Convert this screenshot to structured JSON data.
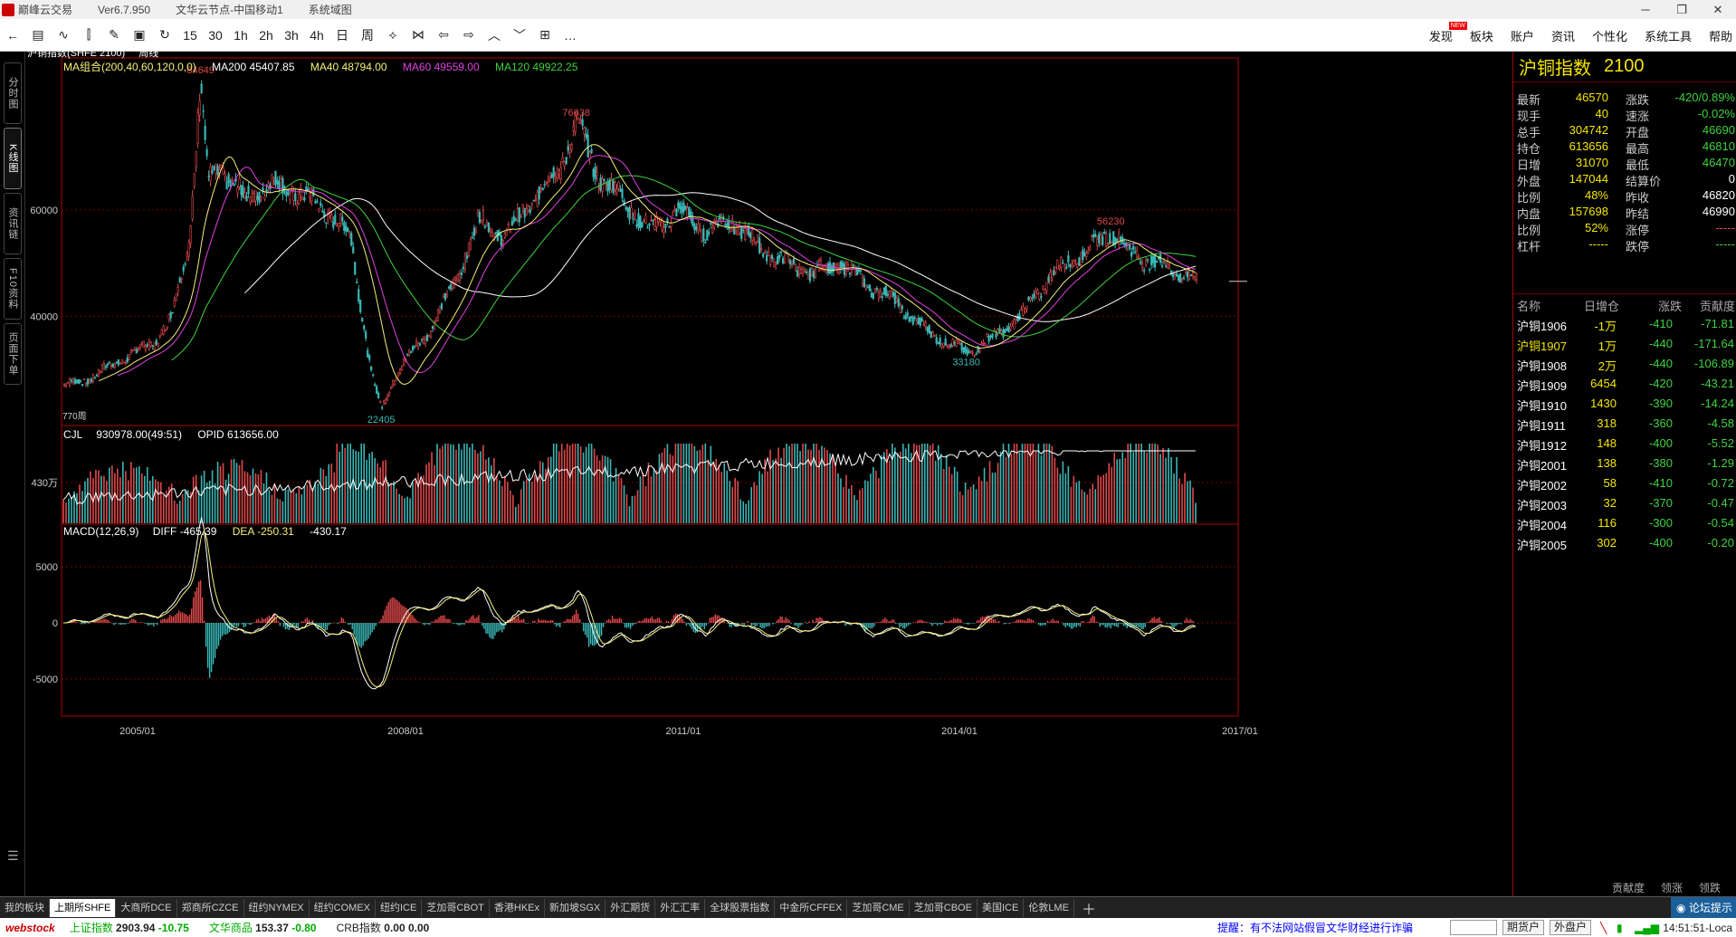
{
  "titlebar": {
    "app": "巅峰云交易",
    "version": "Ver6.7.950",
    "node": "文华云节点-中国移动1",
    "menu": "系统域图"
  },
  "toolbar": {
    "periods": [
      "15",
      "30",
      "1h",
      "2h",
      "3h",
      "4h",
      "日",
      "周"
    ],
    "menu": [
      "发现",
      "板块",
      "账户",
      "资讯",
      "个性化",
      "系统工具",
      "帮助"
    ],
    "new_badge": "NEW"
  },
  "left_tabs": [
    "分时图",
    "K线图",
    "资讯链",
    "F10资料",
    "页面下单"
  ],
  "chart": {
    "contract": "沪铜指数(SHFE 2100)",
    "period": "周线",
    "ma_label": "MA组合(200,40,60,120,0,0)",
    "ma200": "MA200 45407.85",
    "ma40": "MA40 48794.00",
    "ma60": "MA60 49559.00",
    "ma120": "MA120 49922.25",
    "cjl_label": "CJL",
    "cjl_value": "930978.00(49:51)",
    "opid": "OPID 613656.00",
    "macd_label": "MACD(12,26,9)",
    "diff": "DIFF -465.39",
    "dea": "DEA -250.31",
    "macd_val": "-430.17",
    "price_ticks": [
      "60000",
      "40000"
    ],
    "vol_tick": "430万",
    "macd_ticks": [
      "5000",
      "0",
      "-5000"
    ],
    "date_ticks": [
      "2005/01",
      "2008/01",
      "2011/01",
      "2014/01",
      "2017/01"
    ],
    "annotations": [
      "84649",
      "76638",
      "22405",
      "56230",
      "33180",
      "770周"
    ],
    "price_last": "46570",
    "colors": {
      "up": "#e0484a",
      "down": "#39b7b6",
      "ma200": "#ffffff",
      "ma40": "#f5f07a",
      "ma60": "#e040e0",
      "ma120": "#3fd23f"
    }
  },
  "quote": {
    "name": "沪铜指数",
    "code": "2100",
    "left": [
      {
        "label": "最新",
        "value": "46570"
      },
      {
        "label": "现手",
        "value": "40"
      },
      {
        "label": "总手",
        "value": "304742"
      },
      {
        "label": "持仓",
        "value": "613656"
      },
      {
        "label": "日增",
        "value": "31070"
      },
      {
        "label": "外盘",
        "value": "147044"
      },
      {
        "label": "比例",
        "value": "48%"
      },
      {
        "label": "内盘",
        "value": "157698"
      },
      {
        "label": "比例",
        "value": "52%"
      },
      {
        "label": "杠杆",
        "value": "-----"
      }
    ],
    "right": [
      {
        "label": "涨跌",
        "value": "-420/0.89%",
        "color": "#3fd23f"
      },
      {
        "label": "速涨",
        "value": "-0.02%",
        "color": "#3fd23f"
      },
      {
        "label": "开盘",
        "value": "46690",
        "color": "#3fd23f"
      },
      {
        "label": "最高",
        "value": "46810",
        "color": "#3fd23f"
      },
      {
        "label": "最低",
        "value": "46470",
        "color": "#3fd23f"
      },
      {
        "label": "结算价",
        "value": "0",
        "color": "#ffffff"
      },
      {
        "label": "昨收",
        "value": "46820",
        "color": "#ffffff"
      },
      {
        "label": "昨结",
        "value": "46990",
        "color": "#ffffff"
      },
      {
        "label": "涨停",
        "value": "-----",
        "color": "#e0484a"
      },
      {
        "label": "跌停",
        "value": "-----",
        "color": "#3fd23f"
      }
    ],
    "list_header": [
      "名称",
      "日增仓",
      "涨跌",
      "贡献度"
    ],
    "contracts": [
      {
        "name": "沪铜1906",
        "oi": "-1万",
        "chg": "-410",
        "contrib": "-71.81",
        "highlight": false
      },
      {
        "name": "沪铜1907",
        "oi": "1万",
        "chg": "-440",
        "contrib": "-171.64",
        "highlight": true
      },
      {
        "name": "沪铜1908",
        "oi": "2万",
        "chg": "-440",
        "contrib": "-106.89",
        "highlight": false
      },
      {
        "name": "沪铜1909",
        "oi": "6454",
        "chg": "-420",
        "contrib": "-43.21",
        "highlight": false
      },
      {
        "name": "沪铜1910",
        "oi": "1430",
        "chg": "-390",
        "contrib": "-14.24",
        "highlight": false
      },
      {
        "name": "沪铜1911",
        "oi": "318",
        "chg": "-360",
        "contrib": "-4.58",
        "highlight": false
      },
      {
        "name": "沪铜1912",
        "oi": "148",
        "chg": "-400",
        "contrib": "-5.52",
        "highlight": false
      },
      {
        "name": "沪铜2001",
        "oi": "138",
        "chg": "-380",
        "contrib": "-1.29",
        "highlight": false
      },
      {
        "name": "沪铜2002",
        "oi": "58",
        "chg": "-410",
        "contrib": "-0.72",
        "highlight": false
      },
      {
        "name": "沪铜2003",
        "oi": "32",
        "chg": "-370",
        "contrib": "-0.47",
        "highlight": false
      },
      {
        "name": "沪铜2004",
        "oi": "116",
        "chg": "-300",
        "contrib": "-0.54",
        "highlight": false
      },
      {
        "name": "沪铜2005",
        "oi": "302",
        "chg": "-400",
        "contrib": "-0.20",
        "highlight": false
      }
    ],
    "bottom_tabs": [
      "贡献度",
      "领涨",
      "领跌"
    ]
  },
  "exchange_tabs": [
    "我的板块",
    "上期所SHFE",
    "大商所DCE",
    "郑商所CZCE",
    "纽约NYMEX",
    "纽约COMEX",
    "纽约ICE",
    "芝加哥CBOT",
    "香港HKEx",
    "新加坡SGX",
    "外汇期货",
    "外汇汇率",
    "全球股票指数",
    "中金所CFFEX",
    "芝加哥CME",
    "芝加哥CBOE",
    "美国ICE",
    "伦敦LME"
  ],
  "exchange_active": 1,
  "forum": "论坛提示",
  "status": {
    "brand": "webstock",
    "sh_label": "上证指数",
    "sh_value": "2903.94",
    "sh_chg": "-10.75",
    "wh_label": "文华商品",
    "wh_value": "153.37",
    "wh_chg": "-0.80",
    "crb_label": "CRB指数",
    "crb_value": "0.00",
    "crb_chg": "0.00",
    "notice": "提醒：有不法网站假冒文华财经进行诈骗",
    "btn1": "期货户",
    "btn2": "外盘户",
    "clock": "14:51:51-Loca"
  }
}
